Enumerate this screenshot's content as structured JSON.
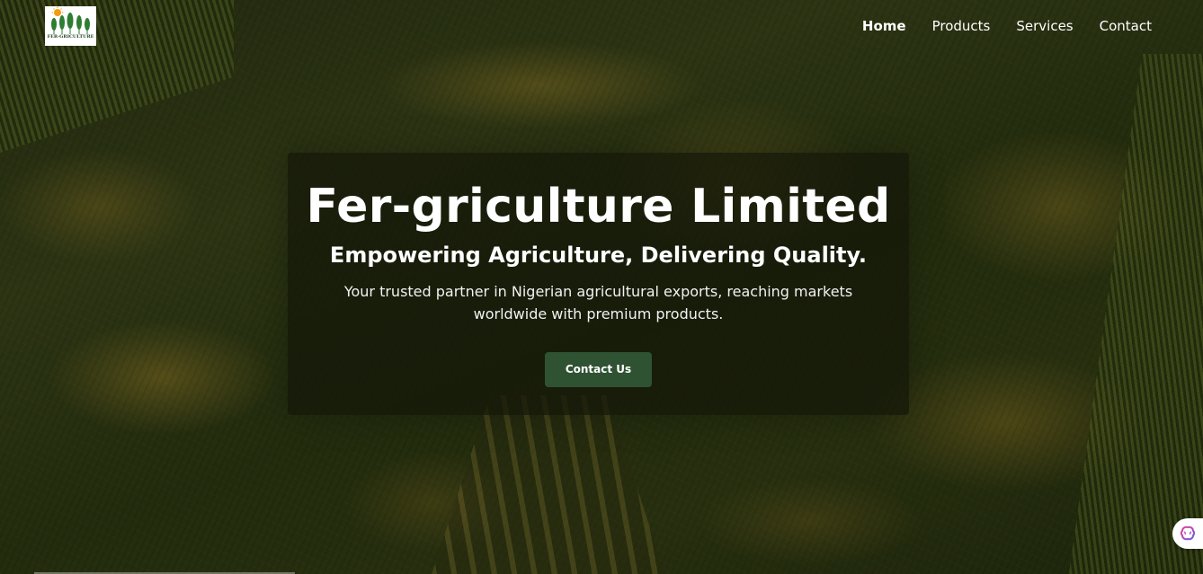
{
  "brand": {
    "logo_text": "FER-GRICULTURE",
    "logo_icon": "wheat-sun-logo-icon"
  },
  "nav": {
    "items": [
      {
        "label": "Home",
        "active": true
      },
      {
        "label": "Products",
        "active": false
      },
      {
        "label": "Services",
        "active": false
      },
      {
        "label": "Contact",
        "active": false
      }
    ]
  },
  "hero": {
    "title": "Fer-griculture Limited",
    "subtitle": "Empowering Agriculture, Delivering Quality.",
    "description": "Your trusted partner in Nigerian agricultural exports, reaching markets worldwide with premium products.",
    "cta_label": "Contact Us"
  },
  "widgets": {
    "assistant_icon": "brain-icon"
  },
  "colors": {
    "accent": "#2f5233",
    "text": "#ffffff",
    "logo_green": "#2e7d32",
    "logo_sun": "#f39c12"
  }
}
